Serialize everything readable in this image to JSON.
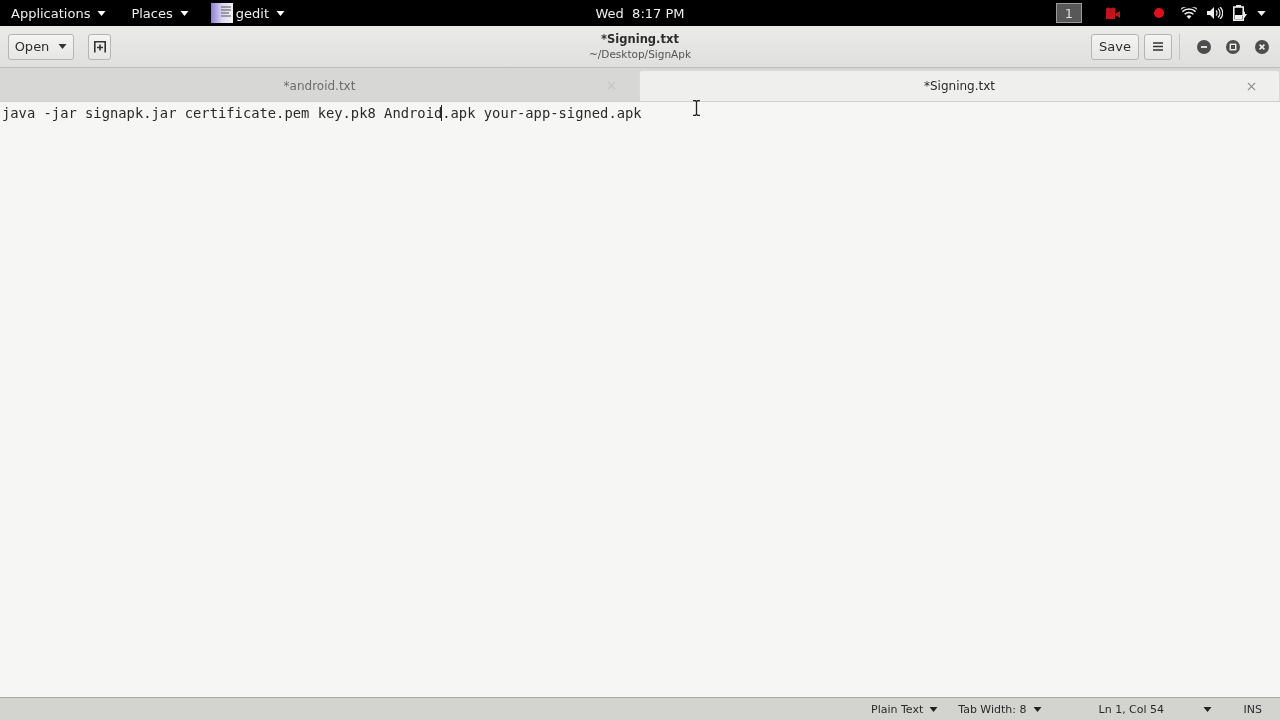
{
  "top_bar": {
    "menus": [
      {
        "label": "Applications",
        "kind": "menu"
      },
      {
        "label": "Places",
        "kind": "menu"
      },
      {
        "label": "gedit",
        "kind": "app"
      }
    ],
    "clock": "Wed  8:17 PM",
    "workspace": "1"
  },
  "header_bar": {
    "open_button": "Open",
    "title": "*Signing.txt",
    "subtitle": "~/Desktop/SignApk",
    "save_button": "Save"
  },
  "tabs": [
    {
      "label": "*android.txt",
      "selected": false
    },
    {
      "label": "*Signing.txt",
      "selected": true
    }
  ],
  "editor": {
    "text_before_caret": "java -jar signapk.jar certificate.pem key.pk8 Android",
    "text_after_caret": ".apk your-app-signed.apk"
  },
  "status_bar": {
    "language": "Plain Text",
    "tab_width": "Tab Width: 8",
    "position": "Ln 1, Col 54",
    "mode": "INS"
  }
}
